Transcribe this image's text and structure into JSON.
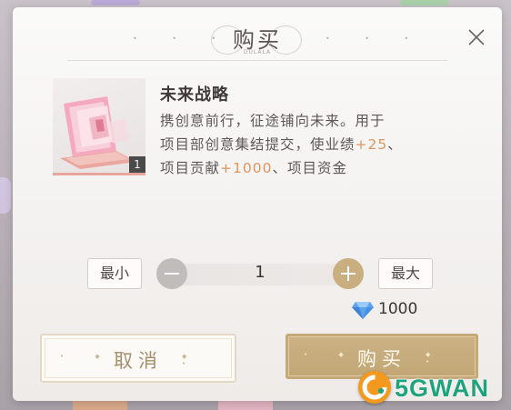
{
  "dialog": {
    "title": "购买",
    "title_sub": "DULALA",
    "close_icon": "close-icon"
  },
  "item": {
    "icon": "laptop-folder-icon",
    "count": "1",
    "name": "未来战略",
    "desc_line1": "携创意前行，征途铺向未来。用于",
    "desc_line2_prefix": "项目部创意集结提交，使业绩",
    "desc_line2_highlight": "+25",
    "desc_line2_suffix": "、",
    "desc_line3_prefix": "项目贡献",
    "desc_line3_highlight": "+1000",
    "desc_line3_suffix": "、项目资金"
  },
  "quantity": {
    "min_label": "最小",
    "max_label": "最大",
    "value": "1",
    "minus_icon": "minus-icon",
    "plus_icon": "plus-icon"
  },
  "cost": {
    "currency_icon": "diamond-icon",
    "value": "1000"
  },
  "buttons": {
    "cancel_label": "取消",
    "buy_label": "购买"
  },
  "watermark": {
    "text": "5GWAN"
  },
  "colors": {
    "highlight": "#e09560",
    "buy_button": "#c6aa79",
    "cancel_text": "#a58e6c",
    "watermark_green": "#1fa37c"
  }
}
